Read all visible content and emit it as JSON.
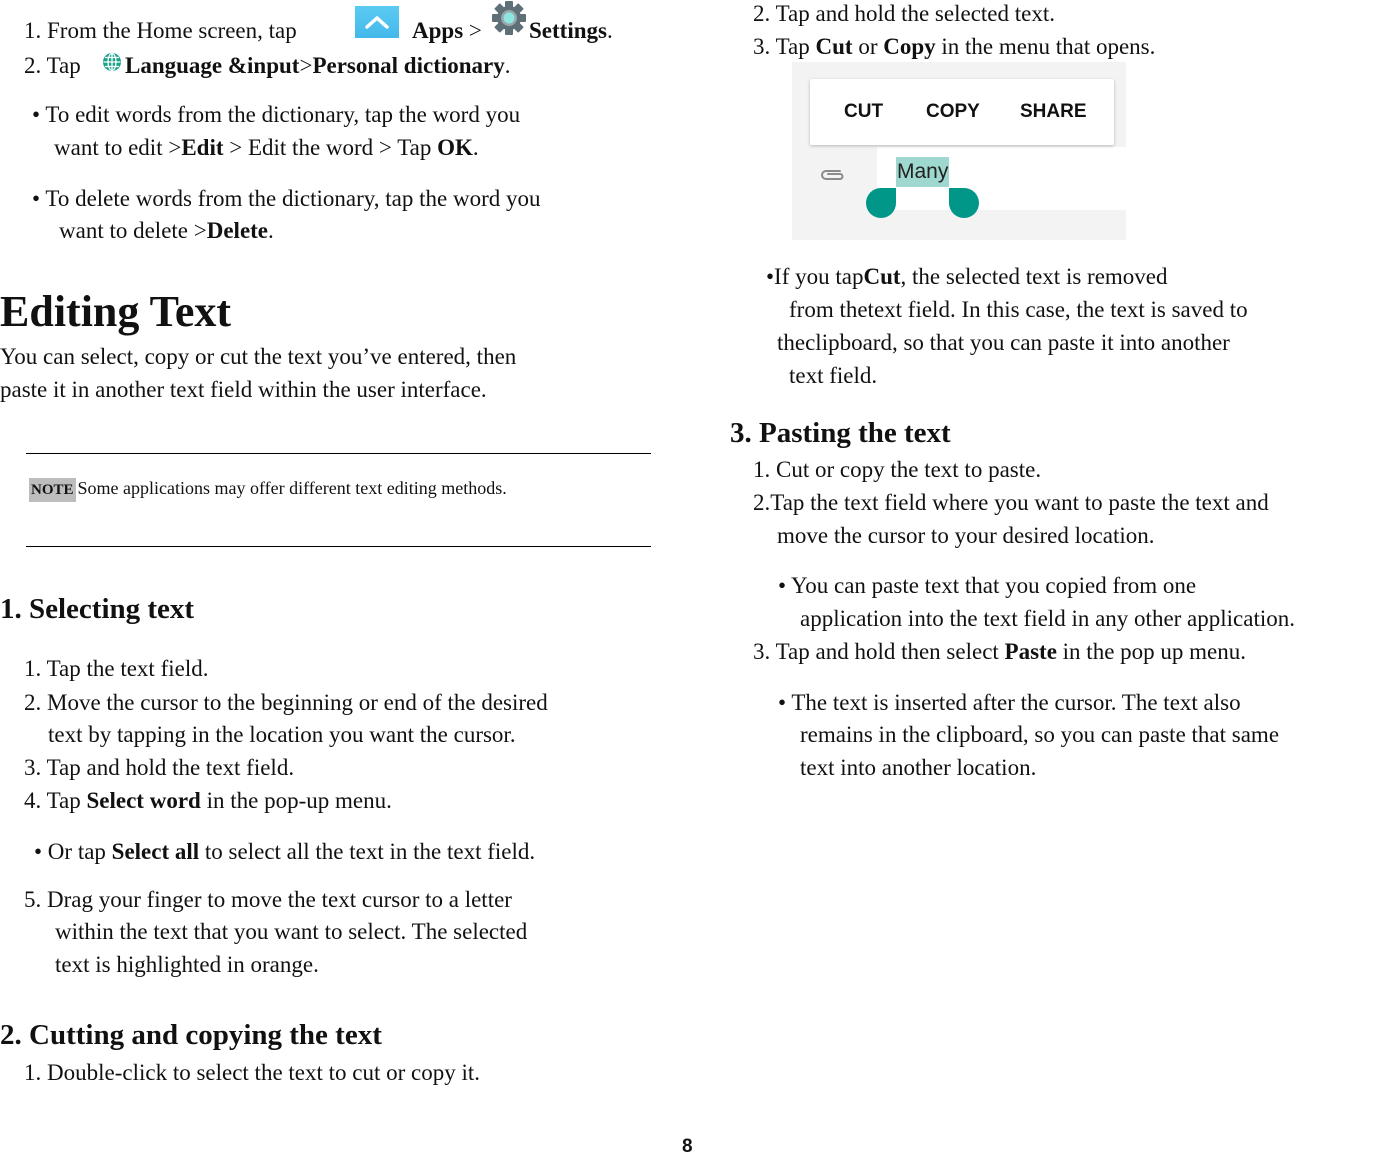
{
  "left": {
    "step1": {
      "prefix": "1. From the Home screen, tap",
      "apps": "Apps",
      "sep": " >",
      "settings": "Settings",
      "end": "."
    },
    "step2": {
      "prefix": "2. Tap",
      "lang": "Language &input",
      "sep": ">",
      "dict": "Personal dictionary",
      "end": "."
    },
    "bullet_edit": {
      "line1": "• To edit words from the dictionary, tap the word you",
      "line2_prefix": "want to edit >",
      "edit": "Edit",
      "line2_mid": " > Edit the word > Tap ",
      "ok": "OK",
      "end": "."
    },
    "bullet_delete": {
      "line1": "• To delete words from the dictionary, tap the word you",
      "line2_prefix": "want to delete >",
      "delete": "Delete",
      "end": "."
    },
    "title": "Editing Text",
    "intro": [
      "You can select, copy or cut the text you’ve entered, then",
      "paste it in another text field within the user interface."
    ],
    "note": {
      "badge": "NOTE",
      "text": "Some applications may offer different text editing methods."
    },
    "section1": {
      "heading": "1. Selecting text",
      "s1": "1. Tap the text field.",
      "s2": [
        "2. Move the cursor to the beginning or end of the desired",
        "text by tapping in the location you want the cursor."
      ],
      "s3": "3. Tap and hold the text field.",
      "s4": {
        "prefix": "4. Tap ",
        "bold": "Select word",
        "suffix": " in the pop-up menu."
      },
      "bullet": {
        "prefix": "• Or tap ",
        "bold": "Select all",
        "suffix": " to select all the text in the text field."
      },
      "s5": [
        "5. Drag your finger to move the text cursor to a letter",
        "within the text that you want to select. The selected",
        "text is highlighted in orange."
      ]
    },
    "section2": {
      "heading": "2. Cutting and copying the text",
      "s1": "1. Double-click to select the text to cut or copy it."
    }
  },
  "right": {
    "s2": "2. Tap and hold the selected text.",
    "s3": {
      "prefix": "3. Tap ",
      "cut": "Cut",
      "or": " or ",
      "copy": "Copy",
      "suffix": " in the menu that opens."
    },
    "popup": {
      "items": [
        "CUT",
        "COPY",
        "SHARE"
      ],
      "selected_word": "Many"
    },
    "bullet_cut": {
      "l1_prefix": "•If you tap",
      "l1_bold": "Cut",
      "l1_suffix": ", the selected text is removed",
      "l2": "from thetext field. In this case, the text is saved to",
      "l3": "theclipboard, so that you can paste it into another",
      "l4": "text field."
    },
    "section3": {
      "heading": "3. Pasting the text",
      "s1": "1. Cut or copy the text to paste.",
      "s2": [
        "2.Tap the text field where you want to paste the text and",
        "move the cursor to your desired location."
      ],
      "bullet1": [
        "• You can paste text that you copied from one",
        "application into the text field in any other application."
      ],
      "s3": {
        "prefix": "3. Tap and hold then select ",
        "bold": "Paste",
        "suffix": " in the pop up menu."
      },
      "bullet2": [
        "• The text is inserted after the cursor. The text also",
        "remains in the clipboard, so you can paste that same",
        "text into another location."
      ]
    }
  },
  "colors": {
    "accent_teal": "#009688",
    "selection": "#9ed8cf",
    "apps_blue": "#4fc3f0",
    "note_gray": "#bdbdbd"
  },
  "page_number": "8"
}
